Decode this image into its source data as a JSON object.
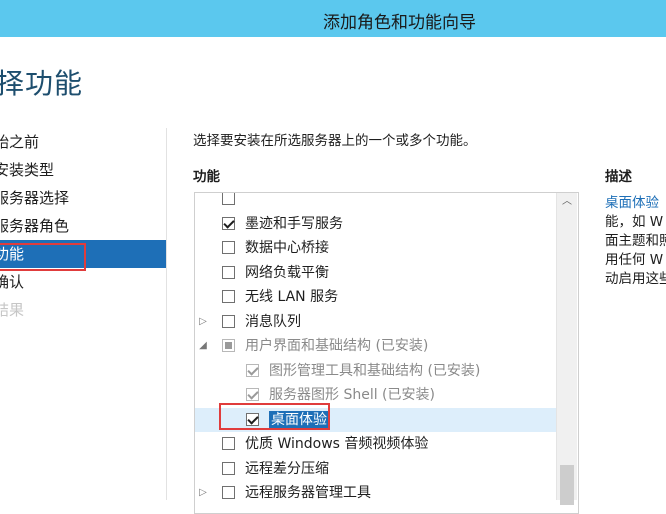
{
  "window": {
    "title": "添加角色和功能向导"
  },
  "page": {
    "heading": "择功能",
    "instruction": "选择要安装在所选服务器上的一个或多个功能。",
    "features_header": "功能",
    "description_header": "描述"
  },
  "steps": [
    {
      "label": "始之前",
      "state": "normal"
    },
    {
      "label": "安装类型",
      "state": "normal"
    },
    {
      "label": "服务器选择",
      "state": "normal"
    },
    {
      "label": "服务器角色",
      "state": "normal"
    },
    {
      "label": "功能",
      "state": "active"
    },
    {
      "label": "确认",
      "state": "normal"
    },
    {
      "label": "结果",
      "state": "disabled"
    }
  ],
  "features": [
    {
      "label": "",
      "checked": false,
      "expander": "",
      "indent": 0
    },
    {
      "label": "墨迹和手写服务",
      "checked": true,
      "expander": "",
      "indent": 0
    },
    {
      "label": "数据中心桥接",
      "checked": false,
      "expander": "",
      "indent": 0
    },
    {
      "label": "网络负载平衡",
      "checked": false,
      "expander": "",
      "indent": 0
    },
    {
      "label": "无线 LAN 服务",
      "checked": false,
      "expander": "",
      "indent": 0
    },
    {
      "label": "消息队列",
      "checked": false,
      "expander": "▷",
      "indent": 0
    },
    {
      "label": "用户界面和基础结构 (已安装)",
      "checked": "partial",
      "expander": "◢",
      "indent": 0,
      "installed": true
    },
    {
      "label": "图形管理工具和基础结构 (已安装)",
      "checked": true,
      "expander": "",
      "indent": 1,
      "installed": true
    },
    {
      "label": "服务器图形 Shell (已安装)",
      "checked": true,
      "expander": "",
      "indent": 1,
      "installed": true
    },
    {
      "label": "桌面体验",
      "checked": true,
      "expander": "",
      "indent": 1,
      "selected": true
    },
    {
      "label": "优质 Windows 音频视频体验",
      "checked": false,
      "expander": "",
      "indent": 0
    },
    {
      "label": "远程差分压缩",
      "checked": false,
      "expander": "",
      "indent": 0
    },
    {
      "label": "远程服务器管理工具",
      "checked": false,
      "expander": "▷",
      "indent": 0
    }
  ],
  "description": {
    "title": "桌面体验",
    "lines": [
      "能，如 W",
      "面主题和照",
      "用任何 W",
      "动启用这些"
    ]
  },
  "colors": {
    "titlebar": "#5bc8ee",
    "accent": "#1e6fb7",
    "highlight_box": "#e03c3c"
  },
  "icons": {
    "scroll_up": "chevron-up-icon",
    "checked": "checkmark-icon",
    "expand": "expand-arrow-icon"
  }
}
